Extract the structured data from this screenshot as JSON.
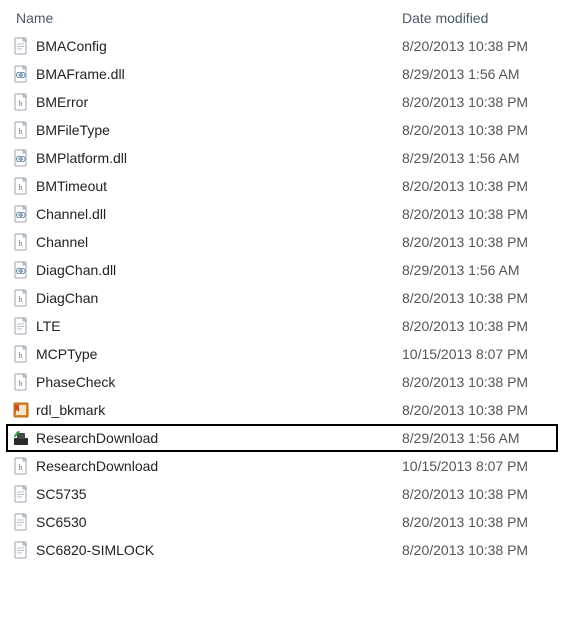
{
  "columns": {
    "name": "Name",
    "date": "Date modified"
  },
  "files": [
    {
      "icon": "text-file-icon",
      "name": "BMAConfig",
      "date": "8/20/2013 10:38 PM",
      "highlighted": false
    },
    {
      "icon": "dll-file-icon",
      "name": "BMAFrame.dll",
      "date": "8/29/2013 1:56 AM",
      "highlighted": false
    },
    {
      "icon": "header-file-icon",
      "name": "BMError",
      "date": "8/20/2013 10:38 PM",
      "highlighted": false
    },
    {
      "icon": "header-file-icon",
      "name": "BMFileType",
      "date": "8/20/2013 10:38 PM",
      "highlighted": false
    },
    {
      "icon": "dll-file-icon",
      "name": "BMPlatform.dll",
      "date": "8/29/2013 1:56 AM",
      "highlighted": false
    },
    {
      "icon": "header-file-icon",
      "name": "BMTimeout",
      "date": "8/20/2013 10:38 PM",
      "highlighted": false
    },
    {
      "icon": "dll-file-icon",
      "name": "Channel.dll",
      "date": "8/20/2013 10:38 PM",
      "highlighted": false
    },
    {
      "icon": "header-file-icon",
      "name": "Channel",
      "date": "8/20/2013 10:38 PM",
      "highlighted": false
    },
    {
      "icon": "dll-file-icon",
      "name": "DiagChan.dll",
      "date": "8/29/2013 1:56 AM",
      "highlighted": false
    },
    {
      "icon": "header-file-icon",
      "name": "DiagChan",
      "date": "8/20/2013 10:38 PM",
      "highlighted": false
    },
    {
      "icon": "text-file-icon",
      "name": "LTE",
      "date": "8/20/2013 10:38 PM",
      "highlighted": false
    },
    {
      "icon": "header-file-icon",
      "name": "MCPType",
      "date": "10/15/2013 8:07 PM",
      "highlighted": false
    },
    {
      "icon": "header-file-icon",
      "name": "PhaseCheck",
      "date": "8/20/2013 10:38 PM",
      "highlighted": false
    },
    {
      "icon": "bookmark-file-icon",
      "name": "rdl_bkmark",
      "date": "8/20/2013 10:38 PM",
      "highlighted": false
    },
    {
      "icon": "exe-file-icon",
      "name": "ResearchDownload",
      "date": "8/29/2013 1:56 AM",
      "highlighted": true
    },
    {
      "icon": "header-file-icon",
      "name": "ResearchDownload",
      "date": "10/15/2013 8:07 PM",
      "highlighted": false
    },
    {
      "icon": "text-file-icon",
      "name": "SC5735",
      "date": "8/20/2013 10:38 PM",
      "highlighted": false
    },
    {
      "icon": "text-file-icon",
      "name": "SC6530",
      "date": "8/20/2013 10:38 PM",
      "highlighted": false
    },
    {
      "icon": "text-file-icon",
      "name": "SC6820-SIMLOCK",
      "date": "8/20/2013 10:38 PM",
      "highlighted": false
    }
  ]
}
